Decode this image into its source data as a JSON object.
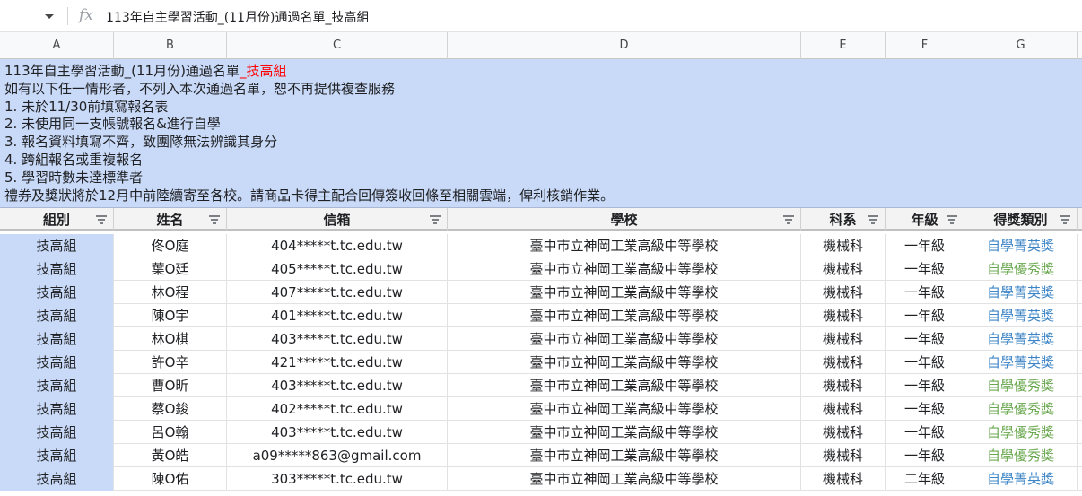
{
  "formula_bar": {
    "fx_label": "fx",
    "content": "113年自主學習活動_(11月份)通過名單_技高組"
  },
  "columns": [
    "A",
    "B",
    "C",
    "D",
    "E",
    "F",
    "G"
  ],
  "notes": {
    "title_prefix": "113年自主學習活動_(11月份)通過名單",
    "title_suffix": "_技高組",
    "lines": [
      "如有以下任一情形者，不列入本次通過名單，恕不再提供複查服務",
      "1. 未於11/30前填寫報名表",
      "2. 未使用同一支帳號報名&進行自學",
      "3. 報名資料填寫不齊，致團隊無法辨識其身分",
      "4. 跨組報名或重複報名",
      "5. 學習時數未達標準者",
      "禮券及獎狀將於12月中前陸續寄至各校。請商品卡得主配合回傳簽收回條至相關雲端，俾利核銷作業。"
    ]
  },
  "table": {
    "headers": [
      "組別",
      "姓名",
      "信箱",
      "學校",
      "科系",
      "年級",
      "得獎類別"
    ],
    "rows": [
      [
        "技高組",
        "佟O庭",
        "404*****t.tc.edu.tw",
        "臺中市立神岡工業高級中等學校",
        "機械科",
        "一年級",
        "自學菁英獎"
      ],
      [
        "技高組",
        "葉O廷",
        "405*****t.tc.edu.tw",
        "臺中市立神岡工業高級中等學校",
        "機械科",
        "一年級",
        "自學優秀獎"
      ],
      [
        "技高組",
        "林O程",
        "407*****t.tc.edu.tw",
        "臺中市立神岡工業高級中等學校",
        "機械科",
        "一年級",
        "自學菁英獎"
      ],
      [
        "技高組",
        "陳O宇",
        "401*****t.tc.edu.tw",
        "臺中市立神岡工業高級中等學校",
        "機械科",
        "一年級",
        "自學菁英獎"
      ],
      [
        "技高組",
        "林O棋",
        "403*****t.tc.edu.tw",
        "臺中市立神岡工業高級中等學校",
        "機械科",
        "一年級",
        "自學菁英獎"
      ],
      [
        "技高組",
        "許O辛",
        "421*****t.tc.edu.tw",
        "臺中市立神岡工業高級中等學校",
        "機械科",
        "一年級",
        "自學菁英獎"
      ],
      [
        "技高組",
        "曹O昕",
        "403*****t.tc.edu.tw",
        "臺中市立神岡工業高級中等學校",
        "機械科",
        "一年級",
        "自學優秀獎"
      ],
      [
        "技高組",
        "蔡O鋑",
        "402*****t.tc.edu.tw",
        "臺中市立神岡工業高級中等學校",
        "機械科",
        "一年級",
        "自學優秀獎"
      ],
      [
        "技高組",
        "呂O翰",
        "403*****t.tc.edu.tw",
        "臺中市立神岡工業高級中等學校",
        "機械科",
        "一年級",
        "自學優秀獎"
      ],
      [
        "技高組",
        "黃O皓",
        "a09*****863@gmail.com",
        "臺中市立神岡工業高級中等學校",
        "機械科",
        "一年級",
        "自學優秀獎"
      ],
      [
        "技高組",
        "陳O佑",
        "303*****t.tc.edu.tw",
        "臺中市立神岡工業高級中等學校",
        "機械科",
        "二年級",
        "自學菁英獎"
      ]
    ]
  },
  "colors": {
    "award_elite": "#3d85c6",
    "award_excellent": "#6aa84f",
    "notes_background": "#c9daf8",
    "title_suffix": "#ff0000"
  }
}
